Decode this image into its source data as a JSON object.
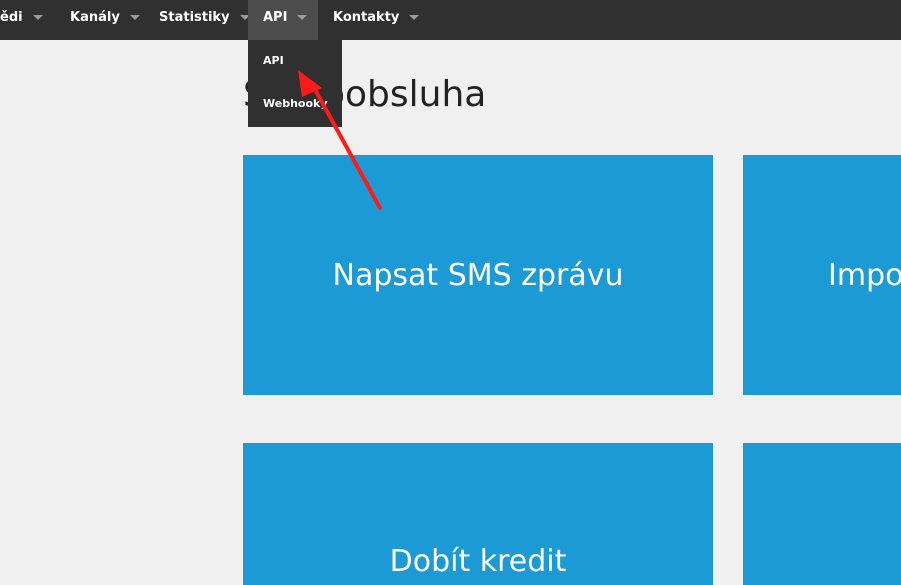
{
  "navbar": {
    "items": [
      {
        "label": "ědi"
      },
      {
        "label": "Kanály"
      },
      {
        "label": "Statistiky"
      },
      {
        "label": "API"
      },
      {
        "label": "Kontakty"
      }
    ]
  },
  "dropdown": {
    "items": [
      {
        "label": "API"
      },
      {
        "label": "Webhooky"
      }
    ]
  },
  "page": {
    "title": "Samoobsluha"
  },
  "tiles": [
    {
      "label": "Napsat SMS zprávu"
    },
    {
      "label": "Impo"
    },
    {
      "label": "Dobít kredit"
    },
    {
      "label": ""
    }
  ],
  "colors": {
    "navbar_bg": "#303030",
    "nav_active_bg": "#4d4d4d",
    "tile_bg": "#1b9ad6",
    "page_bg": "#f0f0f0",
    "annotation_arrow": "#ff1a1a"
  }
}
